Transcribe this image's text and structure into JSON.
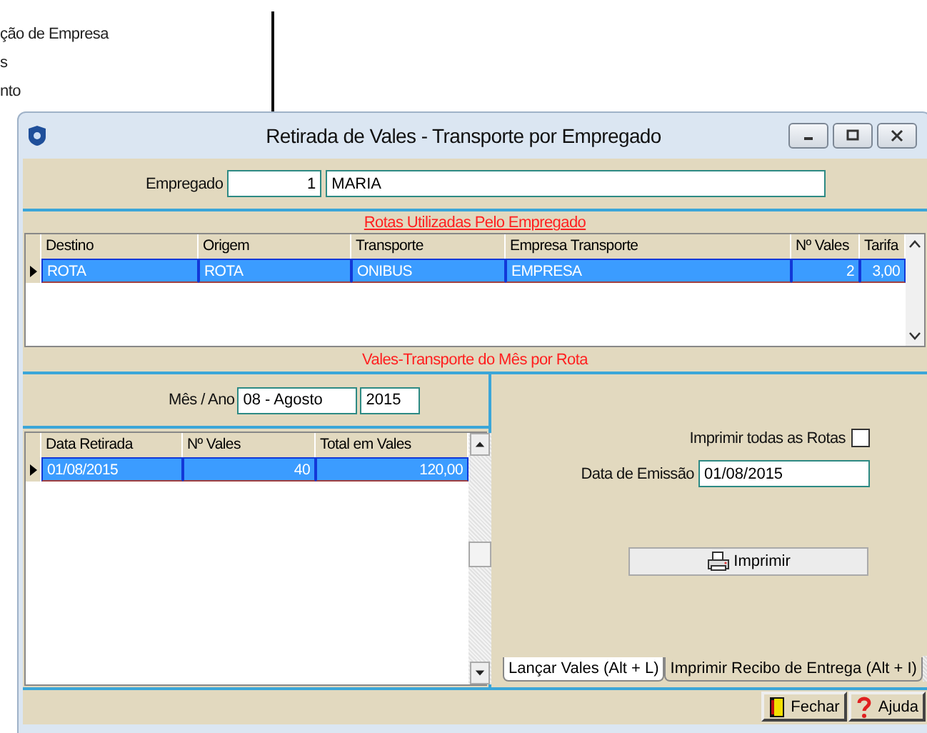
{
  "background": {
    "items": [
      "ção de Empresa",
      "s",
      "nto"
    ]
  },
  "window": {
    "title": "Retirada de Vales - Transporte por Empregado"
  },
  "employee": {
    "label": "Empregado",
    "code": "1",
    "name": "MARIA"
  },
  "routes": {
    "title": "Rotas Utilizadas Pelo Empregado",
    "columns": [
      {
        "label": "Destino",
        "numeric": false
      },
      {
        "label": "Origem",
        "numeric": false
      },
      {
        "label": "Transporte",
        "numeric": false
      },
      {
        "label": "Empresa Transporte",
        "numeric": false
      },
      {
        "label": "Nº Vales",
        "numeric": true
      },
      {
        "label": "Tarifa",
        "numeric": true
      }
    ],
    "rows": [
      {
        "selected": true,
        "cells": [
          "ROTA",
          "ROTA",
          "ONIBUS",
          "EMPRESA",
          "2",
          "3,00"
        ]
      }
    ]
  },
  "monthly": {
    "title": "Vales-Transporte do Mês por Rota",
    "period_label": "Mês / Ano",
    "month": "08 - Agosto",
    "year": "2015",
    "columns": [
      {
        "label": "Data Retirada",
        "numeric": false
      },
      {
        "label": "Nº Vales",
        "numeric": true
      },
      {
        "label": "Total em Vales",
        "numeric": true
      }
    ],
    "rows": [
      {
        "selected": true,
        "cells": [
          "01/08/2015",
          "40",
          "120,00"
        ]
      }
    ]
  },
  "print_panel": {
    "all_routes_label": "Imprimir todas as Rotas",
    "all_routes_checked": false,
    "emission_label": "Data de Emissão",
    "emission_date": "01/08/2015",
    "print_button": "Imprimir"
  },
  "tabs": [
    {
      "label": "Lançar Vales (Alt + L)",
      "selected": true
    },
    {
      "label": "Imprimir Recibo de Entrega (Alt + I)",
      "selected": false
    }
  ],
  "footer_buttons": [
    {
      "kind": "close",
      "label": "Fechar"
    },
    {
      "kind": "help",
      "label": "Ajuda"
    }
  ]
}
